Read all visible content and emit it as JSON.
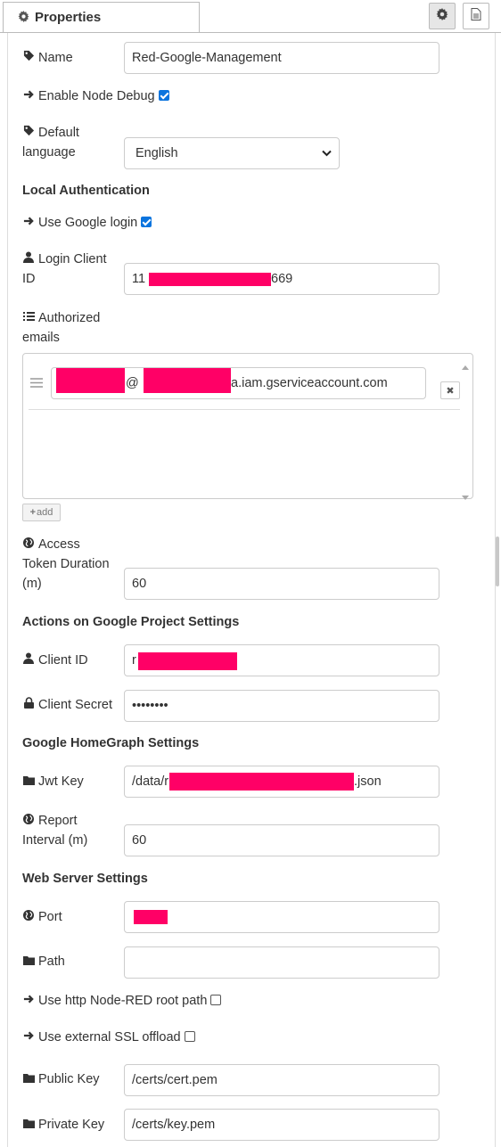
{
  "tab": {
    "title": "Properties"
  },
  "fields": {
    "name": {
      "label": "Name",
      "value": "Red-Google-Management"
    },
    "debug": {
      "label": "Enable Node Debug"
    },
    "language": {
      "label_line1": "Default",
      "label_line2": "language",
      "value": "English"
    },
    "google_login": {
      "label": "Use Google login"
    },
    "login_client_id": {
      "label_line1": "Login Client",
      "label_line2": "ID",
      "prefix": "11",
      "suffix": "669"
    },
    "authorized_emails": {
      "label_line1": "Authorized",
      "label_line2": "emails",
      "email_mid": "@",
      "email_end": "a.iam.gserviceaccount.com",
      "add_label": "add"
    },
    "token_duration": {
      "label_line1": "Access",
      "label_line2": "Token Duration",
      "label_line3": "(m)",
      "value": "60"
    },
    "client_id": {
      "label": "Client ID",
      "prefix": "r"
    },
    "client_secret": {
      "label": "Client Secret",
      "value": "••••••••"
    },
    "jwt_key": {
      "label": "Jwt Key",
      "prefix": "/data/r",
      "suffix": ".json"
    },
    "report_interval": {
      "label_line1": "Report",
      "label_line2": "Interval (m)",
      "value": "60"
    },
    "port": {
      "label": "Port"
    },
    "path": {
      "label": "Path",
      "value": ""
    },
    "http_root": {
      "label": "Use http Node-RED root path"
    },
    "ssl_offload": {
      "label": "Use external SSL offload"
    },
    "public_key": {
      "label": "Public Key",
      "value": "/certs/cert.pem"
    },
    "private_key": {
      "label": "Private Key",
      "value": "/certs/key.pem"
    }
  },
  "sections": {
    "local_auth": "Local Authentication",
    "actions_google": "Actions on Google Project Settings",
    "homegraph": "Google HomeGraph Settings",
    "web_server": "Web Server Settings"
  },
  "icons": {
    "tab": "gear-icon",
    "settings_button": "gear-icon",
    "description_button": "file-icon",
    "tag": "tag-icon",
    "arrow": "arrow-right-icon",
    "user": "user-icon",
    "list": "list-icon",
    "globe": "globe-icon",
    "lock": "lock-icon",
    "folder": "folder-icon"
  },
  "colors": {
    "redaction": "#ff0066",
    "checkbox": "#0b74de"
  }
}
